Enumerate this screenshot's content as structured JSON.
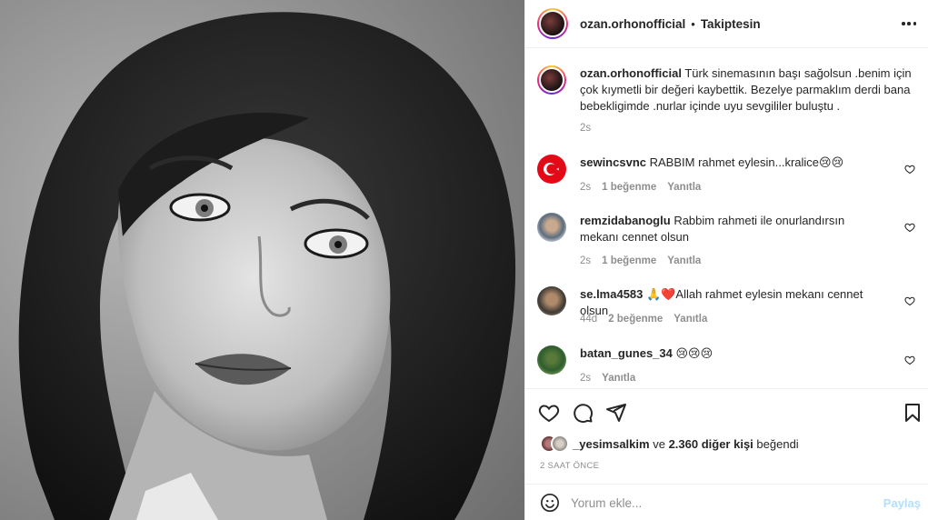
{
  "post": {
    "author": "ozan.orhonofficial",
    "separator": "•",
    "follow_status": "Takiptesin",
    "caption_username": "ozan.orhonofficial",
    "caption_text": "Türk sinemasının başı sağolsun .benim için çok kıymetli bir değeri kaybettik. Bezelye parmaklım derdi bana bebekligimde .nurlar içinde uyu sevgililer buluştu .",
    "caption_time": "2s"
  },
  "comments": [
    {
      "username": "sewincsvnc",
      "text": "RABBIM rahmet eylesin...kralice😢😢",
      "time": "2s",
      "likes": "1 beğenme",
      "reply": "Yanıtla"
    },
    {
      "username": "remzidabanoglu",
      "text": "Rabbim rahmeti ile onurlandırsın mekanı cennet olsun",
      "time": "2s",
      "likes": "1 beğenme",
      "reply": "Yanıtla"
    },
    {
      "username": "se.lma4583",
      "text": "🙏❤️Allah rahmet eylesin mekanı cennet olsun",
      "time": "44d",
      "likes": "2 beğenme",
      "reply": "Yanıtla"
    },
    {
      "username": "batan_gunes_34",
      "text": "😢😢😢",
      "time": "2s",
      "likes": "",
      "reply": "Yanıtla"
    }
  ],
  "likes": {
    "first_user": "_yesimsalkim",
    "connector": "ve",
    "others": "2.360 diğer kişi",
    "suffix": "beğendi"
  },
  "time_ago": "2 SAAT ÖNCE",
  "composer": {
    "placeholder": "Yorum ekle...",
    "post_label": "Paylaş"
  },
  "icons": {
    "like": "heart-icon",
    "comment": "comment-icon",
    "share": "share-icon",
    "save": "bookmark-icon",
    "emoji": "emoji-icon",
    "more": "more-options-icon"
  },
  "colors": {
    "text": "#262626",
    "muted": "#8e8e8e",
    "post_button_disabled": "#b2dffc",
    "border": "#efefef"
  }
}
